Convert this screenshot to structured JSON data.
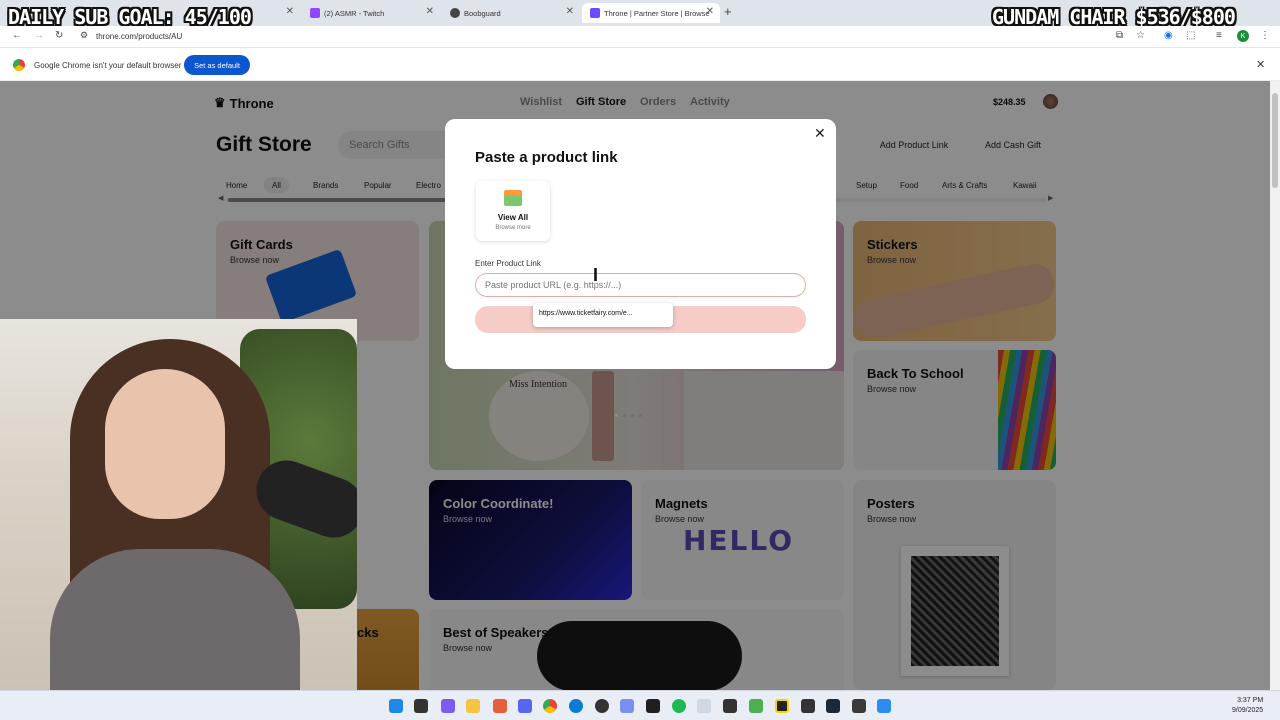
{
  "overlay": {
    "left_goal": "DAILY SUB GOAL: 45/100",
    "right_goal": "GUNDAM CHAIR $536/$800"
  },
  "browser": {
    "tabs": [
      {
        "label": "(2) ASMR - Twitch",
        "favicon_color": "#9146ff"
      },
      {
        "label": "Boobguard",
        "favicon_color": "#444444"
      },
      {
        "label": "Throne | Partner Store | Browse",
        "favicon_color": "#6a4cff",
        "active": true
      }
    ],
    "url": "throne.com/products/AU",
    "infobar": {
      "message": "Google Chrome isn't your default browser",
      "button": "Set as default"
    },
    "profile_initial": "K"
  },
  "site": {
    "logo": "Throne",
    "nav": [
      "Wishlist",
      "Gift Store",
      "Orders",
      "Activity"
    ],
    "balance": "$248.35",
    "page_title": "Gift Store",
    "search_placeholder": "Search Gifts",
    "add_product_link": "Add Product Link",
    "add_cash_gift": "Add Cash Gift",
    "categories_left": [
      "Home",
      "All",
      "Brands",
      "Popular",
      "Electro"
    ],
    "categories_right": [
      "Setup",
      "Food",
      "Arts & Crafts",
      "Kawaii"
    ],
    "cards": {
      "gift_cards": {
        "title": "Gift Cards",
        "sub": "Browse now"
      },
      "stickers": {
        "title": "Stickers",
        "sub": "Browse now"
      },
      "back_to_school": {
        "title": "Back To School",
        "sub": "Browse now"
      },
      "color_coordinate": {
        "title": "Color Coordinate!",
        "sub": "Browse now"
      },
      "magnets": {
        "title": "Magnets",
        "sub": "Browse now"
      },
      "posters": {
        "title": "Posters",
        "sub": "Browse now"
      },
      "best_speakers": {
        "title": "Best of Speakers",
        "sub": "Browse now"
      },
      "partial": {
        "title": "cks"
      }
    },
    "magnets_art": "HELLO",
    "hero_text": "Miss Intention"
  },
  "modal": {
    "title": "Paste a product link",
    "view_all_title": "View All",
    "view_all_sub": "Browse more",
    "input_label": "Enter Product Link",
    "input_placeholder": "Paste product URL (e.g. https://...)",
    "autocomplete_suggestion": "https://www.ticketfairy.com/e..."
  },
  "taskbar": {
    "time": "3:37 PM",
    "date": "9/09/2025"
  },
  "colors": {
    "accent_blue": "#0b57d0",
    "submit_pink": "#f5cdc6",
    "color_coordinate_bg": "#1a1a6e"
  }
}
